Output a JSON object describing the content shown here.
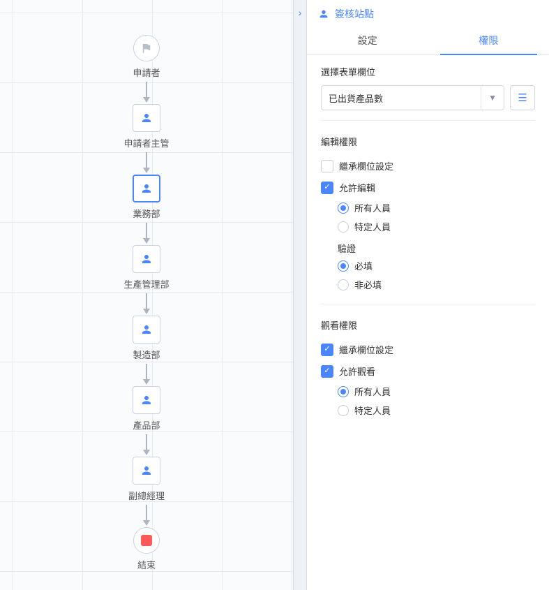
{
  "flow": {
    "nodes": [
      {
        "kind": "start",
        "label": "申請者"
      },
      {
        "kind": "person",
        "label": "申請者主管"
      },
      {
        "kind": "person",
        "label": "業務部",
        "selected": true
      },
      {
        "kind": "person",
        "label": "生產管理部"
      },
      {
        "kind": "person",
        "label": "製造部"
      },
      {
        "kind": "person",
        "label": "產品部"
      },
      {
        "kind": "person",
        "label": "副總經理"
      },
      {
        "kind": "end",
        "label": "結束"
      }
    ]
  },
  "panel": {
    "title": "簽核站點",
    "tabs": {
      "settings": "設定",
      "permission": "權限",
      "active": "permission"
    },
    "field_section": {
      "title": "選擇表單欄位",
      "selected_value": "已出貨產品數"
    },
    "edit_perm": {
      "title": "編輯權限",
      "inherit": {
        "label": "繼承欄位設定",
        "checked": false
      },
      "allow_edit": {
        "label": "允許編輯",
        "checked": true
      },
      "scope": {
        "all": "所有人員",
        "specific": "特定人員",
        "selected": "all"
      },
      "validation": {
        "title": "驗證",
        "required": "必填",
        "optional": "非必填",
        "selected": "required"
      }
    },
    "view_perm": {
      "title": "觀看權限",
      "inherit": {
        "label": "繼承欄位設定",
        "checked": true
      },
      "allow_view": {
        "label": "允許觀看",
        "checked": true
      },
      "scope": {
        "all": "所有人員",
        "specific": "特定人員",
        "selected": "all"
      }
    }
  }
}
